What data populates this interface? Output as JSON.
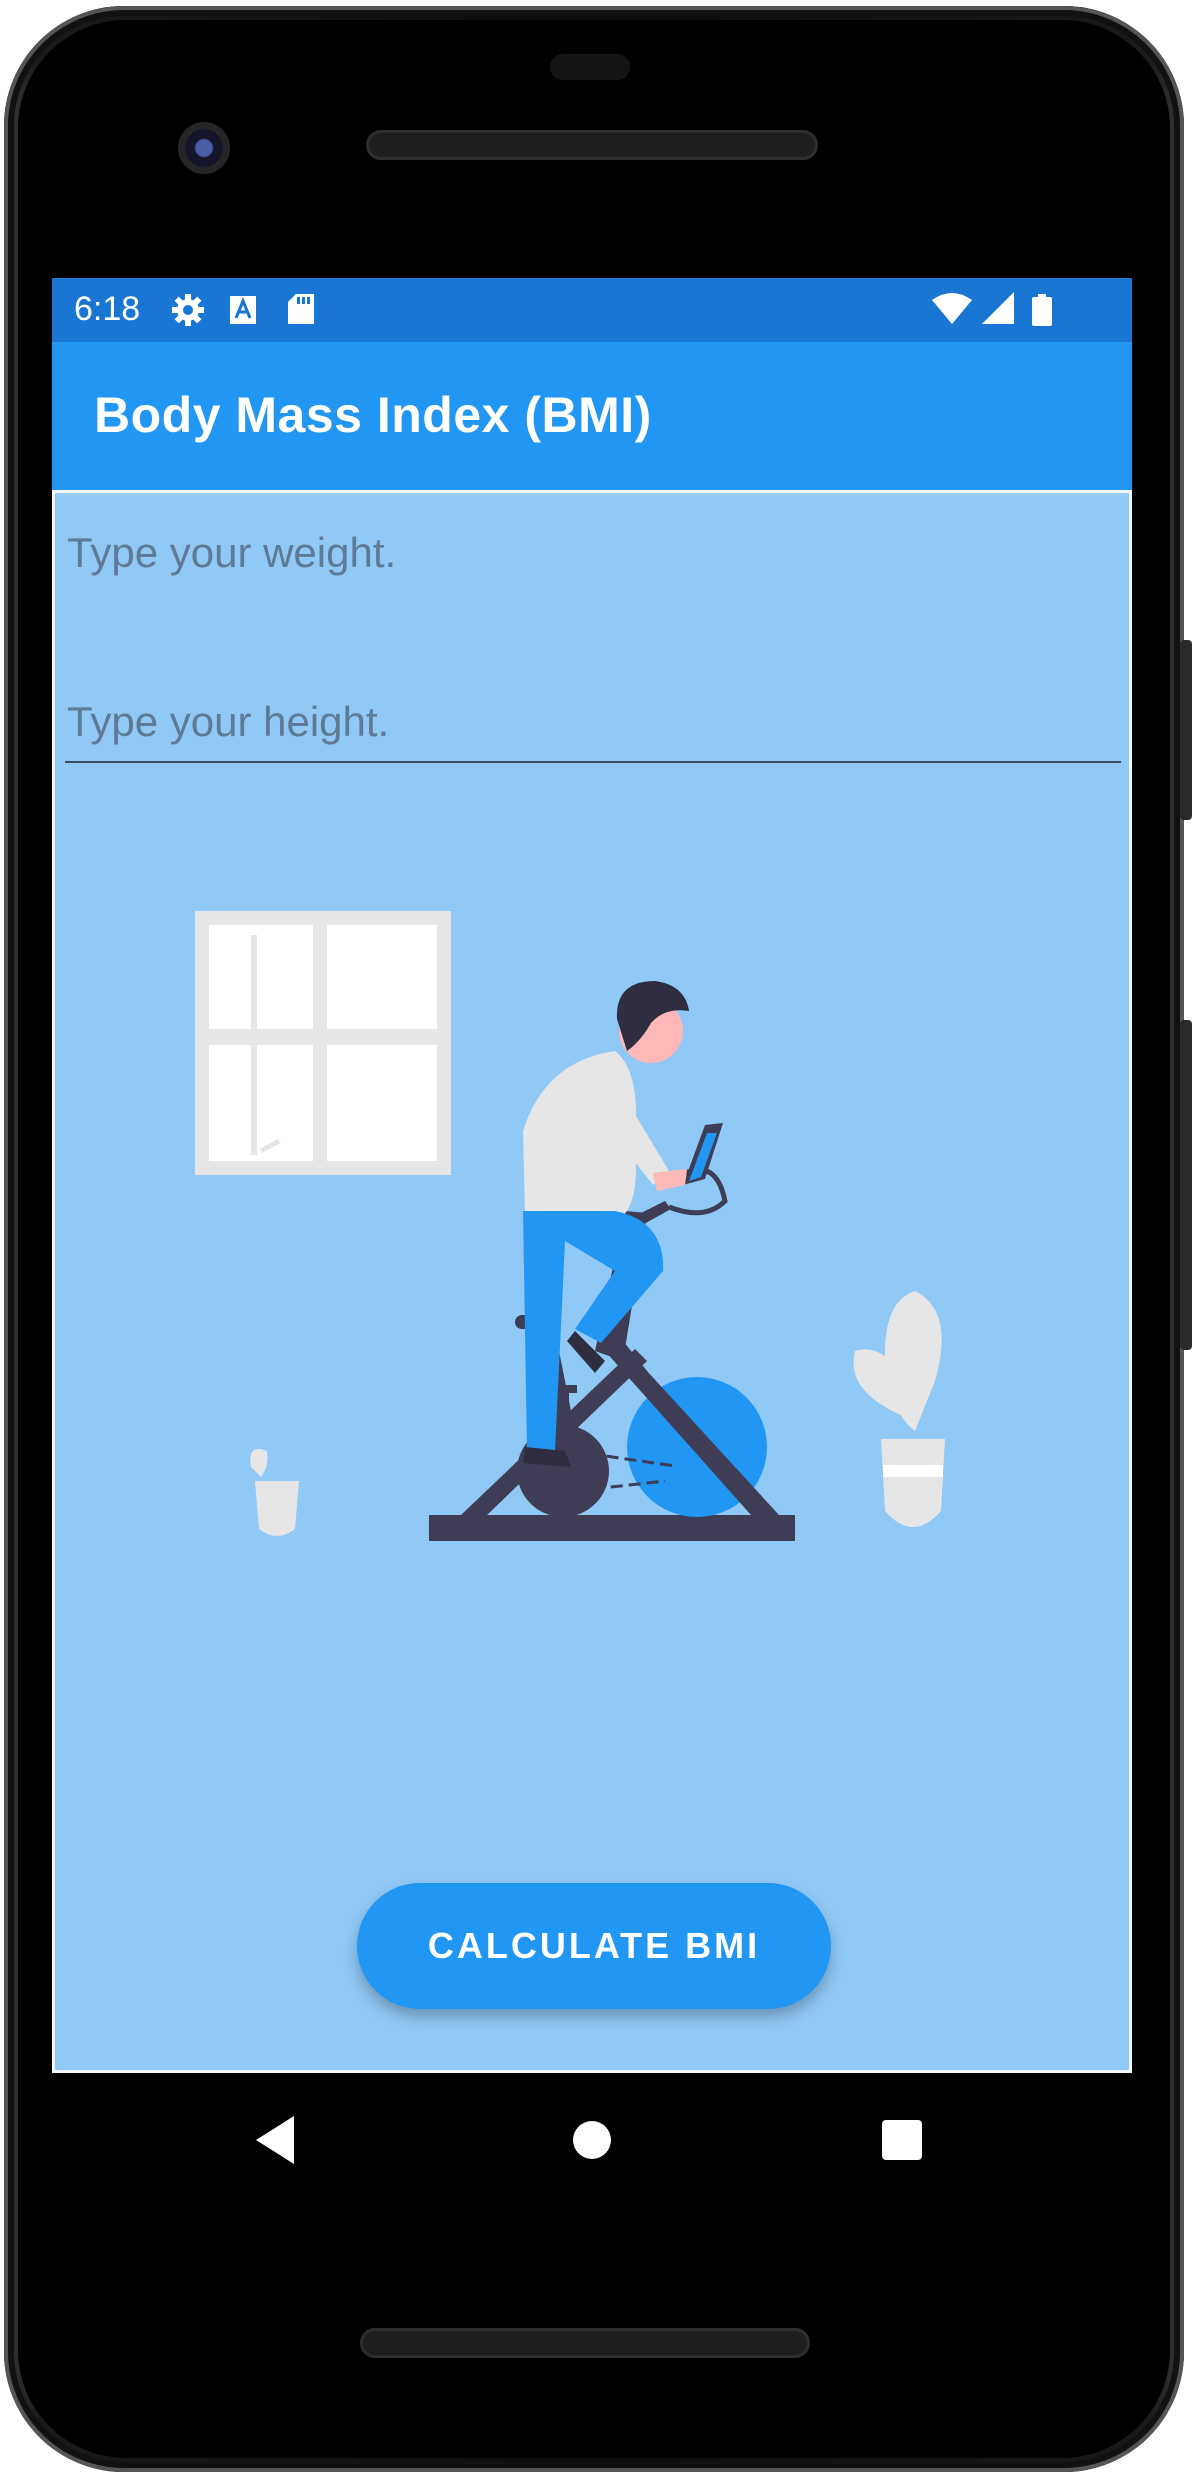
{
  "status_bar": {
    "time": "6:18",
    "left_icons": [
      "gear-icon",
      "keyboard-a-icon",
      "sd-card-icon"
    ],
    "right_icons": [
      "wifi-icon",
      "signal-icon",
      "battery-icon"
    ]
  },
  "app_bar": {
    "title": "Body Mass Index (BMI)"
  },
  "form": {
    "weight_placeholder": "Type your weight.",
    "height_placeholder": "Type your height."
  },
  "actions": {
    "calculate_label": "CALCULATE BMI"
  },
  "nav_bar": {
    "buttons": [
      "back-icon",
      "home-icon",
      "recents-icon"
    ]
  },
  "colors": {
    "status_bar": "#1976d2",
    "app_bar": "#2196f3",
    "background": "#90c8f6",
    "button": "#2196f3"
  }
}
